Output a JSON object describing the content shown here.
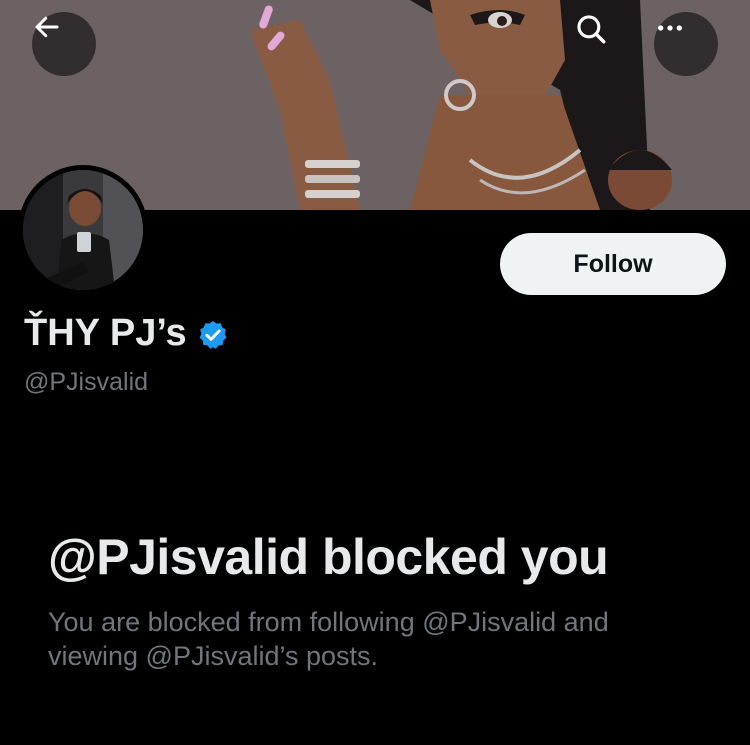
{
  "header": {
    "back_icon": "arrow-left-icon",
    "search_icon": "search-icon",
    "more_icon": "more-horizontal-icon"
  },
  "profile": {
    "display_name": "ŤHY PJ’s",
    "verified": true,
    "verified_color": "#1d9bf0",
    "handle": "@PJisvalid",
    "follow_label": "Follow"
  },
  "blocked": {
    "title": "@PJisvalid blocked you",
    "description": "You are blocked from following @PJisvalid and viewing @PJisvalid’s posts."
  },
  "colors": {
    "background": "#000000",
    "primary_text": "#e7e9ea",
    "secondary_text": "#71767b",
    "button_bg": "#eff3f4",
    "button_text": "#0f1419"
  }
}
